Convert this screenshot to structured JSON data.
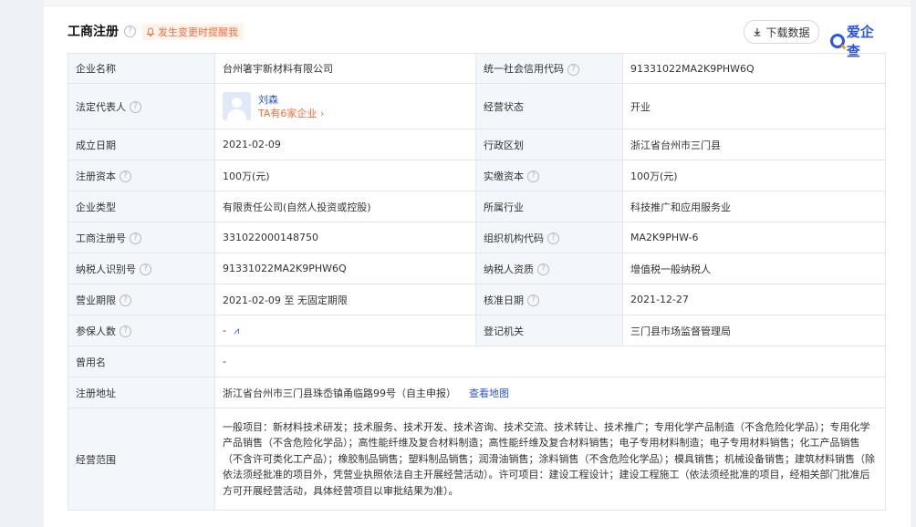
{
  "header": {
    "title": "工商注册",
    "alert": "发生变更时提醒我",
    "download_label": "下载数据",
    "logo_text": "爱企查"
  },
  "colors": {
    "accent": "#2a55e5",
    "alert": "#ff6a3d",
    "label_bg": "#f3f6fa"
  },
  "table": {
    "company_name_label": "企业名称",
    "company_name": "台州箸宇新材料有限公司",
    "credit_code_label": "统一社会信用代码",
    "credit_code": "91331022MA2K9PHW6Q",
    "legal_rep_label": "法定代表人",
    "legal_rep_name": "刘森",
    "legal_rep_companies": "TA有6家企业 ›",
    "status_label": "经营状态",
    "status": "开业",
    "founded_label": "成立日期",
    "founded": "2021-02-09",
    "region_label": "行政区划",
    "region": "浙江省台州市三门县",
    "reg_capital_label": "注册资本",
    "reg_capital": "100万(元)",
    "paid_capital_label": "实缴资本",
    "paid_capital": "100万(元)",
    "type_label": "企业类型",
    "type": "有限责任公司(自然人投资或控股)",
    "industry_label": "所属行业",
    "industry": "科技推广和应用服务业",
    "reg_no_label": "工商注册号",
    "reg_no": "331022000148750",
    "org_code_label": "组织机构代码",
    "org_code": "MA2K9PHW-6",
    "taxpayer_id_label": "纳税人识别号",
    "taxpayer_id": "91331022MA2K9PHW6Q",
    "taxpayer_type_label": "纳税人资质",
    "taxpayer_type": "增值税一般纳税人",
    "term_label": "营业期限",
    "term": "2021-02-09 至 无固定期限",
    "approved_label": "核准日期",
    "approved": "2021-12-27",
    "insured_label": "参保人数",
    "insured": "-",
    "authority_label": "登记机关",
    "authority": "三门县市场监督管理局",
    "former_name_label": "曾用名",
    "former_name": "-",
    "address_label": "注册地址",
    "address": "浙江省台州市三门县珠岙镇甬临路99号（自主申报）",
    "map_link": "查看地图",
    "scope_label": "经营范围",
    "scope": "一般项目：新材料技术研发；技术服务、技术开发、技术咨询、技术交流、技术转让、技术推广；专用化学产品制造（不含危险化学品）；专用化学产品销售（不含危险化学品）；高性能纤维及复合材料制造；高性能纤维及复合材料销售；电子专用材料制造；电子专用材料销售；化工产品销售（不含许可类化工产品）；橡胶制品销售；塑料制品销售；润滑油销售；涂料销售（不含危险化学品）；模具销售；机械设备销售；建筑材料销售（除依法须经批准的项目外，凭营业执照依法自主开展经营活动）。许可项目：建设工程设计；建设工程施工（依法须经批准的项目，经相关部门批准后方可开展经营活动，具体经营项目以审批结果为准）。"
  }
}
